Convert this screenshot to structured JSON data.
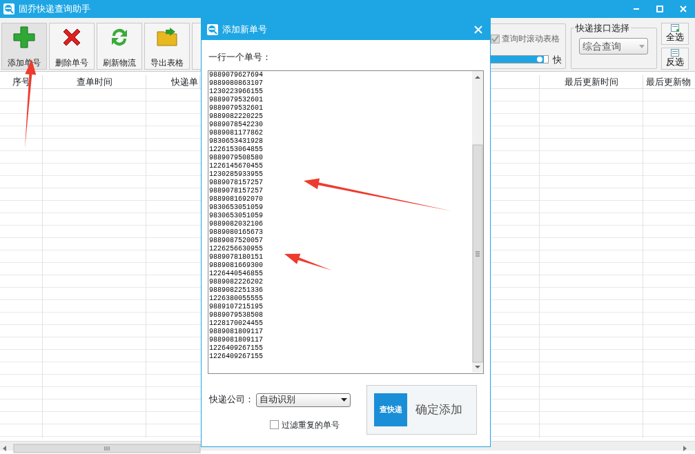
{
  "window": {
    "title": "固乔快递查询助手"
  },
  "toolbar": {
    "buttons": [
      {
        "label": "添加单号",
        "kind": "add",
        "selected": true
      },
      {
        "label": "删除单号",
        "kind": "delete",
        "selected": false
      },
      {
        "label": "刷新物流",
        "kind": "refresh",
        "selected": false
      },
      {
        "label": "导出表格",
        "kind": "export",
        "selected": false
      }
    ],
    "scroll_option": {
      "label": "查询时滚动表格",
      "checked": true,
      "disabled": true
    },
    "speed": {
      "level": 0.93,
      "label": "快"
    },
    "api_group": {
      "title": "快递接口选择",
      "value": "综合查询"
    },
    "select_buttons": [
      {
        "label": "全选",
        "kind": "all"
      },
      {
        "label": "反选",
        "kind": "invert"
      }
    ]
  },
  "table": {
    "columns": [
      {
        "label": "序号"
      },
      {
        "label": "查单时间"
      },
      {
        "label": "快递单"
      },
      {
        "label": "最后更新时间"
      },
      {
        "label": "最后更新物"
      }
    ]
  },
  "dialog": {
    "title": "添加新单号",
    "prompt": "一行一个单号：",
    "tracking_numbers": [
      "9889079627694",
      "9889080863107",
      "1230223966155",
      "9889079532601",
      "9889079532601",
      "9889082220225",
      "9889078542230",
      "9889081177862",
      "9830653431928",
      "1226153064855",
      "9889079508580",
      "1226145670455",
      "1230285933955",
      "9889078157257",
      "9889078157257",
      "9889081692070",
      "9830653051059",
      "9830653051059",
      "9889082032106",
      "9889080165673",
      "9889087520057",
      "1226256630955",
      "9889078180151",
      "9889081669300",
      "1226440546855",
      "9889082226202",
      "9889082251336",
      "1226380055555",
      "9889107215195",
      "9889079538508",
      "1228170024455",
      "9889081809117",
      "9889081809117",
      "1226409267155",
      "1226409267155"
    ],
    "company_label": "快递公司：",
    "company_value": "自动识别",
    "filter_option": {
      "label": "过滤重复的单号",
      "checked": false
    },
    "confirm": {
      "logo_text": "查快递",
      "label": "确定添加"
    }
  }
}
